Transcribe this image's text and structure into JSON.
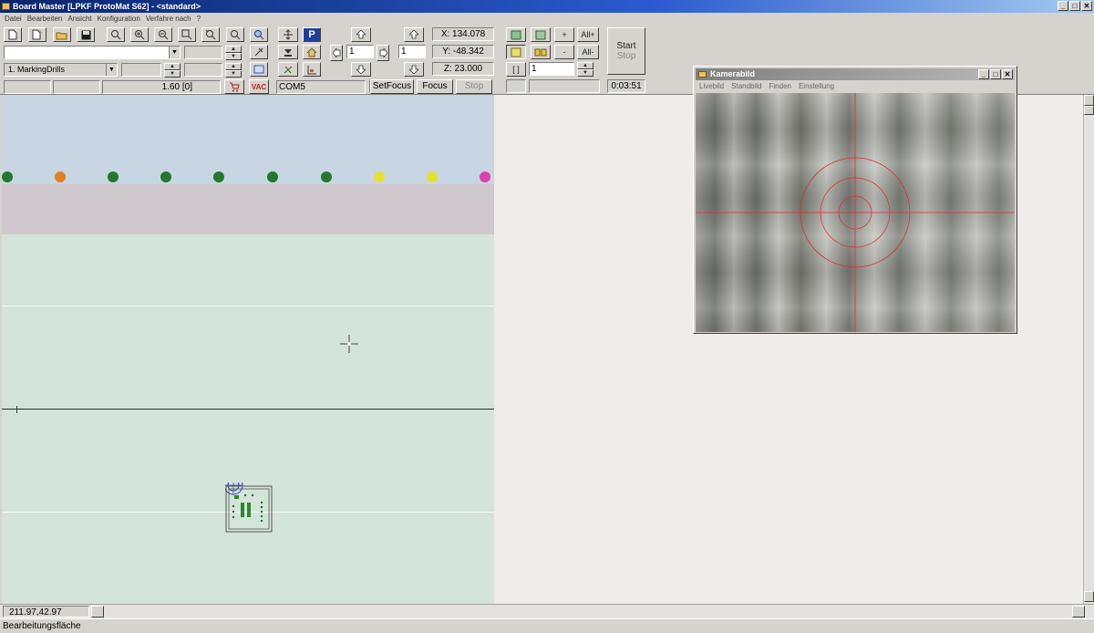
{
  "window": {
    "title": "Board Master [LPKF ProtoMat S62]  - <standard>",
    "controls": [
      "_",
      "□",
      "✕"
    ]
  },
  "menu": [
    "Datei",
    "Bearbeiten",
    "Ansicht",
    "Konfiguration",
    "Verfahre nach",
    "?"
  ],
  "toolbar": {
    "tool_combo": "1. MarkingDrills",
    "tool_value": "1.60 [0]",
    "vac_label": "VAC",
    "port": "COM5",
    "step_value_1": "1",
    "step_value_2": "1",
    "step_value_3": "1",
    "coords": {
      "x": "X: 134.078",
      "y": "Y: -48.342",
      "z": "Z: 23.000"
    },
    "setfocus_label": "SetFocus",
    "focus_label": "Focus",
    "stop_label": "Stop",
    "plus_label": "+",
    "minus_label": "-",
    "all_plus_label": "All+",
    "all_minus_label": "All-",
    "bracket_label": "[ ]",
    "start_label": "Start",
    "start_stop_label": "Stop",
    "timer": "0:03:51",
    "park_label": "P"
  },
  "drill_dots": {
    "colors": [
      "#1f7a2a",
      "#e08020",
      "#1f7a2a",
      "#1f7a2a",
      "#1f7a2a",
      "#1f7a2a",
      "#1f7a2a",
      "#e8e030",
      "#e8e030",
      "#e040b0"
    ]
  },
  "camera": {
    "title": "Kamerabild",
    "menu": [
      "Livebild",
      "Standbild",
      "Finden",
      "Einstellung"
    ]
  },
  "status": {
    "coordinates": "211.97,42.97",
    "text": "Bearbeitungsfläche"
  }
}
